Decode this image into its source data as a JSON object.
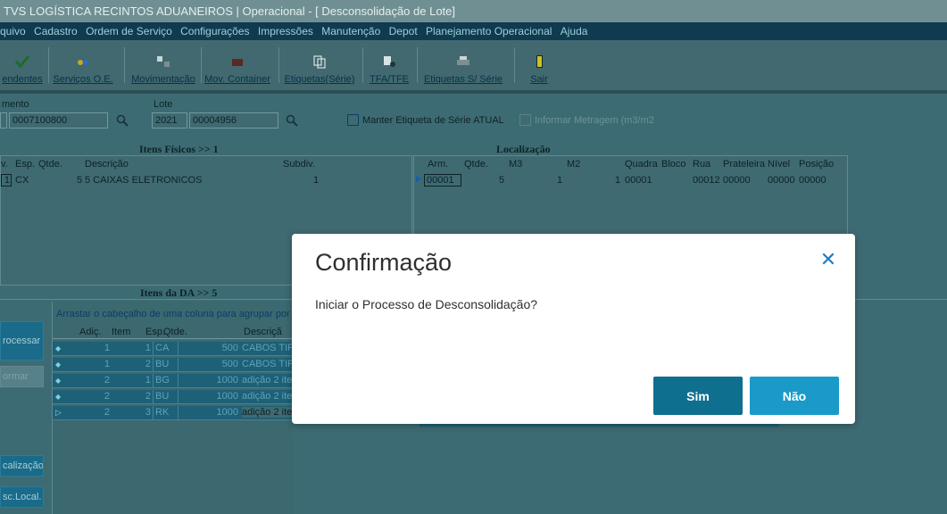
{
  "window": {
    "title": "TVS LOGÍSTICA RECINTOS ADUANEIROS | Operacional - [ Desconsolidação de Lote]"
  },
  "menu": [
    "quivo",
    "Cadastro",
    "Ordem de Serviço",
    "Configurações",
    "Impressões",
    "Manutenção",
    "Depot",
    "Planejamento Operacional",
    "Ajuda"
  ],
  "toolbar": {
    "pendentes": "endentes",
    "servicos": "Serviços O.E.",
    "movimentacao": "Movimentação",
    "mov_container": "Mov. Container",
    "etiquetas_serie": "Etiquetas(Série)",
    "tfa_tfe": "TFA/TFE",
    "etiquetas_s_serie": "Etiquetas S/ Série",
    "sair": "Sair"
  },
  "form": {
    "documento_label": "mento",
    "documento_value": "0007100800",
    "lote_label": "Lote",
    "lote_ano": "2021",
    "lote_numero": "00004956",
    "manter_etiqueta": "Manter Etiqueta de Série ATUAL",
    "informar_metragem": "Informar Metragem (m3/m2"
  },
  "itens_fisicos": {
    "title": "Itens Físicos   >> 1",
    "headers": [
      "v.",
      "Esp.",
      "Qtde.",
      "Descrição",
      "Subdiv."
    ],
    "row": {
      "item": "1",
      "esp": "CX",
      "qtde": "5",
      "descricao": "5 CAIXAS ELETRONICOS",
      "subdiv": "1"
    }
  },
  "localizacao": {
    "title": "Localização",
    "headers": [
      "Arm.",
      "Qtde.",
      "M3",
      "M2",
      "Quadra",
      "Bloco",
      "Rua",
      "Prateleira",
      "Nível",
      "Posição"
    ],
    "row": {
      "arm": "00001",
      "qtde": "5",
      "m3": "1",
      "m2": "1",
      "quadra": "00001",
      "bloco": "",
      "rua": "00012",
      "prateleira": "00000",
      "nivel": "00000",
      "posicao": "00000"
    }
  },
  "itens_da": {
    "title": "Itens da DA   >> 5",
    "hint": "Arrastar o cabeçalho de uma coluna para agrupar por e",
    "headers": [
      "Adiç.",
      "Item",
      "Esp.",
      "Qtde.",
      "Descriçã"
    ],
    "rows": [
      {
        "adic": "1",
        "item": "1",
        "esp": "CA",
        "qtde": "500",
        "desc": "CABOS TIP"
      },
      {
        "adic": "1",
        "item": "2",
        "esp": "BU",
        "qtde": "500",
        "desc": "CABOS TIP"
      },
      {
        "adic": "2",
        "item": "1",
        "esp": "BG",
        "qtde": "1000",
        "desc": "adição 2 ite"
      },
      {
        "adic": "2",
        "item": "2",
        "esp": "BU",
        "qtde": "1000",
        "desc": "adição 2 ite"
      },
      {
        "adic": "2",
        "item": "3",
        "esp": "RK",
        "qtde": "1000",
        "desc": "adição 2 ite"
      }
    ]
  },
  "side_buttons": {
    "processar": "rocessar",
    "informar": "ormar",
    "localizacao": "calização",
    "desc_local": "sc.Local."
  },
  "dialog": {
    "title": "Confirmação",
    "message": "Iniciar o Processo de Desconsolidação?",
    "yes": "Sim",
    "no": "Não"
  },
  "colors": {
    "titlebar": "#6f8f93",
    "menubar": "#0f3a4f",
    "background": "#3d6b73",
    "dialog_yes": "#0f6f8e",
    "dialog_no": "#1a9ac9",
    "close_icon": "#1a7dc8"
  }
}
